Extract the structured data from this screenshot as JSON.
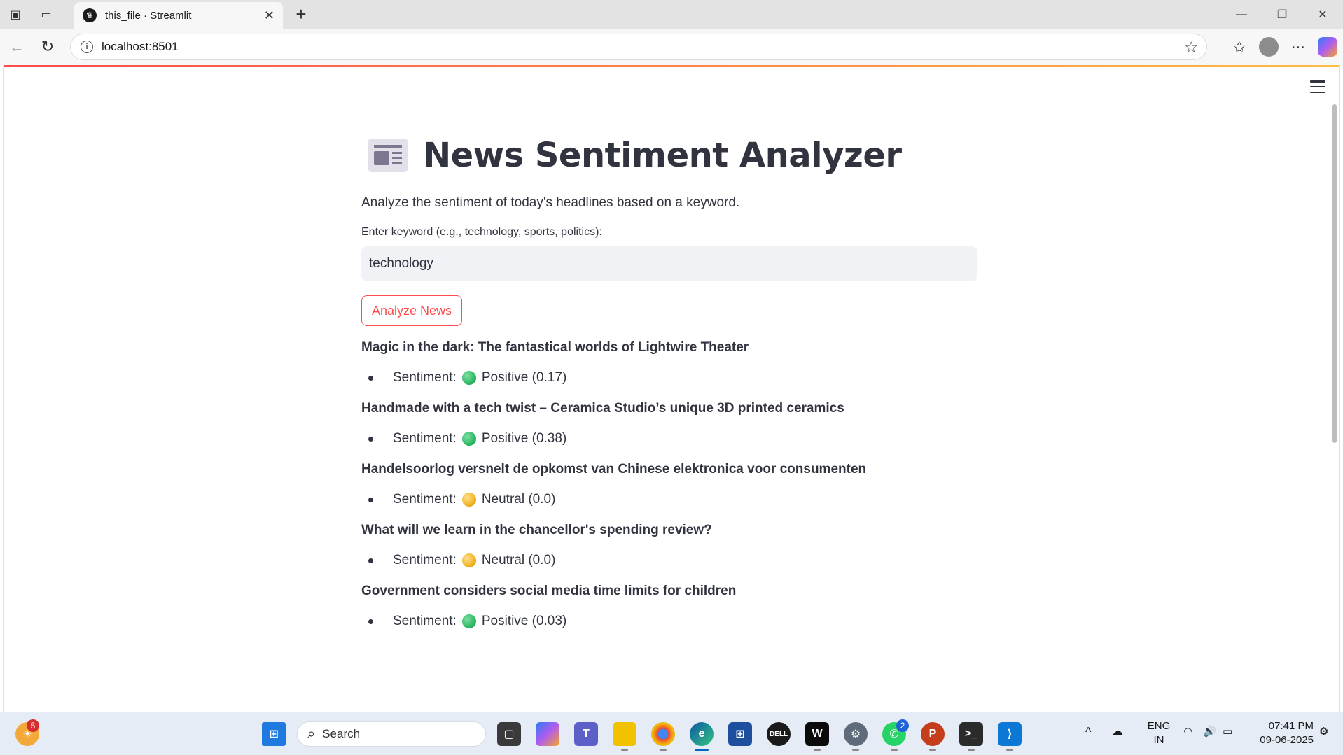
{
  "browser": {
    "tab_title": "this_file · Streamlit",
    "url": "localhost:8501"
  },
  "app": {
    "title": "News Sentiment Analyzer",
    "title_icon": "newspaper-icon",
    "subtitle": "Analyze the sentiment of today's headlines based on a keyword.",
    "keyword_label": "Enter keyword (e.g., technology, sports, politics):",
    "keyword_value": "technology",
    "analyze_button": "Analyze News",
    "sentiment_prefix": "Sentiment:",
    "articles": [
      {
        "headline": "Magic in the dark: The fantastical worlds of Lightwire Theater",
        "sentiment": "Positive (0.17)",
        "kind": "positive"
      },
      {
        "headline": "Handmade with a tech twist – Ceramica Studio’s unique 3D printed ceramics",
        "sentiment": "Positive (0.38)",
        "kind": "positive"
      },
      {
        "headline": "Handelsoorlog versnelt de opkomst van Chinese elektronica voor consumenten",
        "sentiment": "Neutral (0.0)",
        "kind": "neutral"
      },
      {
        "headline": "What will we learn in the chancellor's spending review?",
        "sentiment": "Neutral (0.0)",
        "kind": "neutral"
      },
      {
        "headline": "Government considers social media time limits for children",
        "sentiment": "Positive (0.03)",
        "kind": "positive"
      }
    ],
    "colors": {
      "accent": "#ff4b4b",
      "positive": "#2fb865",
      "neutral": "#f0b429"
    }
  },
  "taskbar": {
    "search_placeholder": "Search",
    "weather_badge": "5",
    "whatsapp_badge": "2",
    "language": "ENG",
    "region": "IN",
    "time": "07:41 PM",
    "date": "09-06-2025"
  }
}
